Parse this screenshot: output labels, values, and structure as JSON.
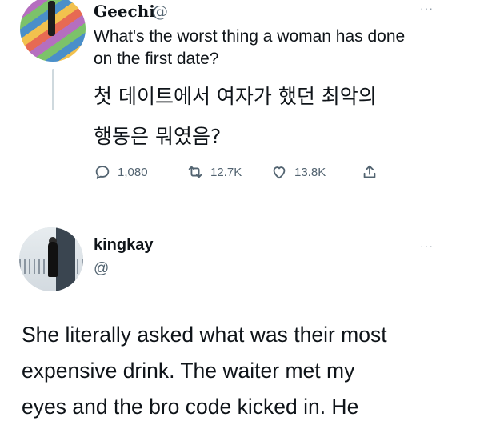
{
  "original_tweet": {
    "author_name": "Geechi",
    "author_handle": "@",
    "more_label": "···",
    "text_en_line1": "What's the worst thing a woman has done",
    "text_en_line2": "on the first date?",
    "text_ko_line1": "첫 데이트에서 여자가 했던 최악의",
    "text_ko_line2": "행동은 뭐였음?",
    "reply_count": "1,080",
    "retweet_count": "12.7K",
    "like_count": "13.8K"
  },
  "reply_tweet": {
    "author_name": "kingkay",
    "author_handle": "@",
    "more_label": "···",
    "text_lines": [
      "She literally asked what was their most",
      "expensive drink. The waiter met my",
      "eyes and the bro code kicked in. He"
    ]
  },
  "icons": {
    "reply": "comment-icon",
    "retweet": "retweet-icon",
    "like": "heart-icon",
    "share": "share-icon"
  },
  "colors": {
    "text_primary": "#0f1419",
    "text_secondary": "#536471",
    "thread_line": "#cfd9de"
  }
}
